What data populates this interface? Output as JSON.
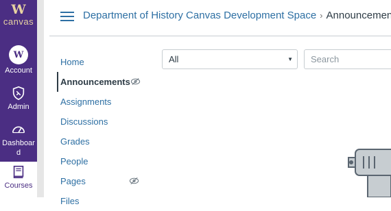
{
  "global_nav": {
    "logo_letter": "W",
    "logo_text": "canvas",
    "items": [
      {
        "label": "Account",
        "avatar": "W"
      },
      {
        "label": "Admin",
        "icon": "shield-icon"
      },
      {
        "label": "Dashboard",
        "icon": "speedometer-icon"
      },
      {
        "label": "Courses",
        "icon": "book-icon"
      }
    ]
  },
  "breadcrumb": {
    "course": "Department of History Canvas Development Space",
    "separator": "›",
    "current": "Announcements"
  },
  "course_nav": {
    "items": [
      {
        "label": "Home"
      },
      {
        "label": "Announcements",
        "active": true,
        "hidden_icon": "eye-slash-icon"
      },
      {
        "label": "Assignments"
      },
      {
        "label": "Discussions"
      },
      {
        "label": "Grades"
      },
      {
        "label": "People"
      },
      {
        "label": "Pages",
        "hidden_icon": "eye-slash-icon"
      },
      {
        "label": "Files"
      }
    ]
  },
  "filter": {
    "selected": "All"
  },
  "search": {
    "placeholder": "Search",
    "value": ""
  },
  "colors": {
    "brand": "#4b2e83",
    "link": "#2d6fa3",
    "text": "#2d3b45"
  }
}
